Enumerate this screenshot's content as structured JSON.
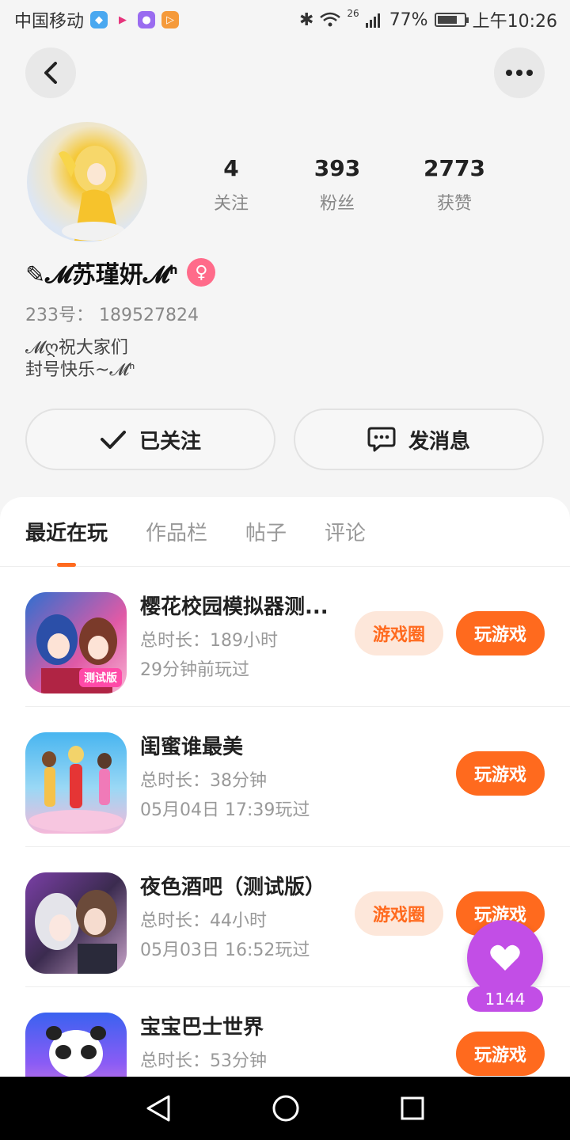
{
  "status_bar": {
    "carrier": "中国移动",
    "network": "26",
    "battery": "77%",
    "battery_level": 0.77,
    "time": "上午10:26"
  },
  "profile": {
    "stats": [
      {
        "value": "4",
        "label": "关注"
      },
      {
        "value": "393",
        "label": "粉丝"
      },
      {
        "value": "2773",
        "label": "获赞"
      }
    ],
    "username": "✎𝓜苏瑾妍𝓜ᑋ",
    "gender_symbol": "♀",
    "id_text": "233号： 189527824",
    "bio": "𝓜ღ祝大家们\n封号快乐~𝓜ᑋ",
    "follow_label": "已关注",
    "message_label": "发消息"
  },
  "tabs": [
    "最近在玩",
    "作品栏",
    "帖子",
    "评论"
  ],
  "games": [
    {
      "title": "樱花校园模拟器测...",
      "duration": "总时长：189小时",
      "last_played": "29分钟前玩过",
      "has_circle": true,
      "icon_tag": "测试版"
    },
    {
      "title": "闺蜜谁最美",
      "duration": "总时长：38分钟",
      "last_played": "05月04日 17:39玩过",
      "has_circle": false,
      "icon_tag": ""
    },
    {
      "title": "夜色酒吧（测试版）",
      "duration": "总时长：44小时",
      "last_played": "05月03日 16:52玩过",
      "has_circle": true,
      "icon_tag": ""
    },
    {
      "title": "宝宝巴士世界",
      "duration": "总时长：53分钟",
      "last_played": "",
      "has_circle": false,
      "icon_tag": ""
    }
  ],
  "buttons": {
    "circle_label": "游戏圈",
    "play_label": "玩游戏"
  },
  "floating_like": {
    "count": "1144"
  },
  "colors": {
    "accent": "#ff6a1e",
    "like_purple": "#c24ee6"
  }
}
